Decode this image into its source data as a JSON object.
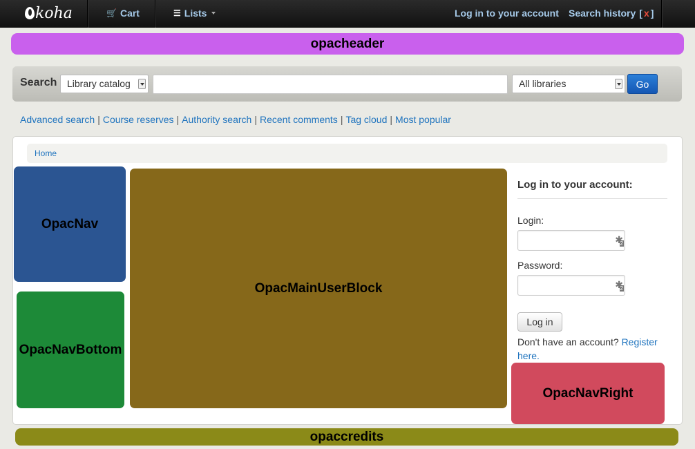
{
  "navbar": {
    "brand": "koha",
    "cart_label": "Cart",
    "lists_label": "Lists",
    "login_label": "Log in to your account",
    "search_history_label": "Search history",
    "search_history_clear": "x",
    "search_history_open_bracket": "[",
    "search_history_close_bracket": "]",
    "cart_icon": "cart-icon",
    "lists_icon": "list-icon"
  },
  "opacheader": {
    "label": "opacheader",
    "color": "#c960ed"
  },
  "search": {
    "label": "Search",
    "catalog_select": "Library catalog",
    "query_value": "",
    "library_select": "All libraries",
    "go_label": "Go"
  },
  "moresearches": {
    "advanced": "Advanced search",
    "course": "Course reserves",
    "authority": "Authority search",
    "comments": "Recent comments",
    "tags": "Tag cloud",
    "popular": "Most popular",
    "separator": "|"
  },
  "breadcrumb": {
    "home": "Home"
  },
  "blocks": {
    "opacnav": {
      "label": "OpacNav",
      "color": "#2b5592"
    },
    "opacnavbottom": {
      "label": "OpacNavBottom",
      "color": "#1d8a38"
    },
    "opacmainuserblock": {
      "label": "OpacMainUserBlock",
      "color": "#86681a"
    },
    "opacnavright": {
      "label": "OpacNavRight",
      "color": "#d14a5d"
    },
    "opaccredits": {
      "label": "opaccredits",
      "color": "#8b8a18"
    }
  },
  "login": {
    "title": "Log in to your account:",
    "login_label": "Login:",
    "login_value": "",
    "password_label": "Password:",
    "password_value": "",
    "button": "Log in",
    "no_account": "Don't have an account?",
    "register_link": "Register here."
  }
}
